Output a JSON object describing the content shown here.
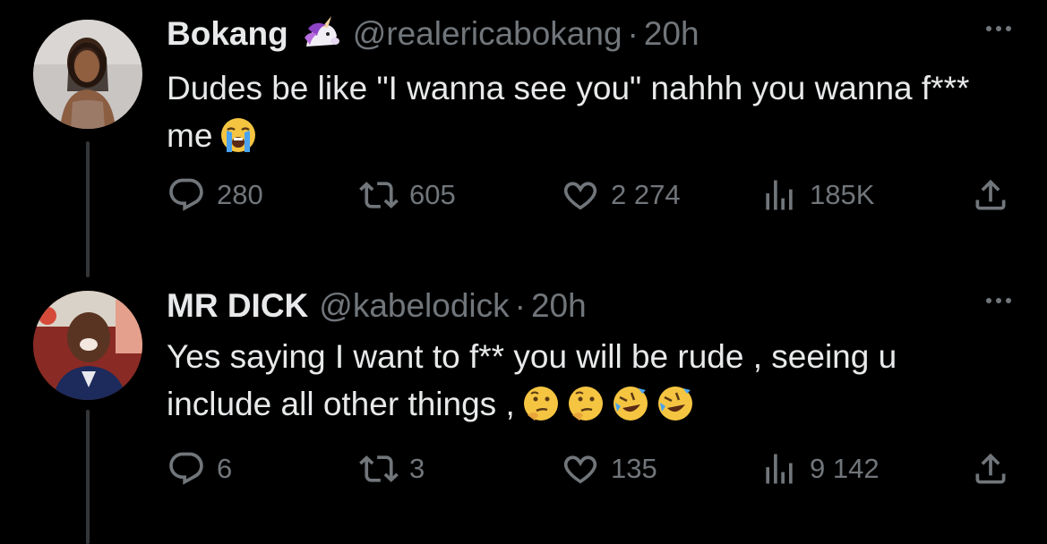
{
  "tweets": [
    {
      "name": "Bokang",
      "name_emoji": "unicorn-emoji",
      "handle": "@realericabokang",
      "separator": "·",
      "time": "20h",
      "text": "Dudes be like \"I wanna see you\" nahhh you wanna f*** me",
      "text_emojis": [
        "loudly-crying-face"
      ],
      "replies": "280",
      "retweets": "605",
      "likes": "2 274",
      "views": "185K"
    },
    {
      "name": "MR DICK",
      "handle": "@kabelodick",
      "separator": "·",
      "time": "20h",
      "text": "Yes saying I want to f** you will be rude , seeing u include all other things ,",
      "text_emojis": [
        "thinking-face",
        "thinking-face",
        "rolling-on-floor-laughing",
        "rolling-on-floor-laughing"
      ],
      "replies": "6",
      "retweets": "3",
      "likes": "135",
      "views": "9 142"
    }
  ],
  "colors": {
    "background": "#000000",
    "primary_text": "#e7e9ea",
    "secondary_text": "#71767b",
    "thread_line": "#333639"
  }
}
